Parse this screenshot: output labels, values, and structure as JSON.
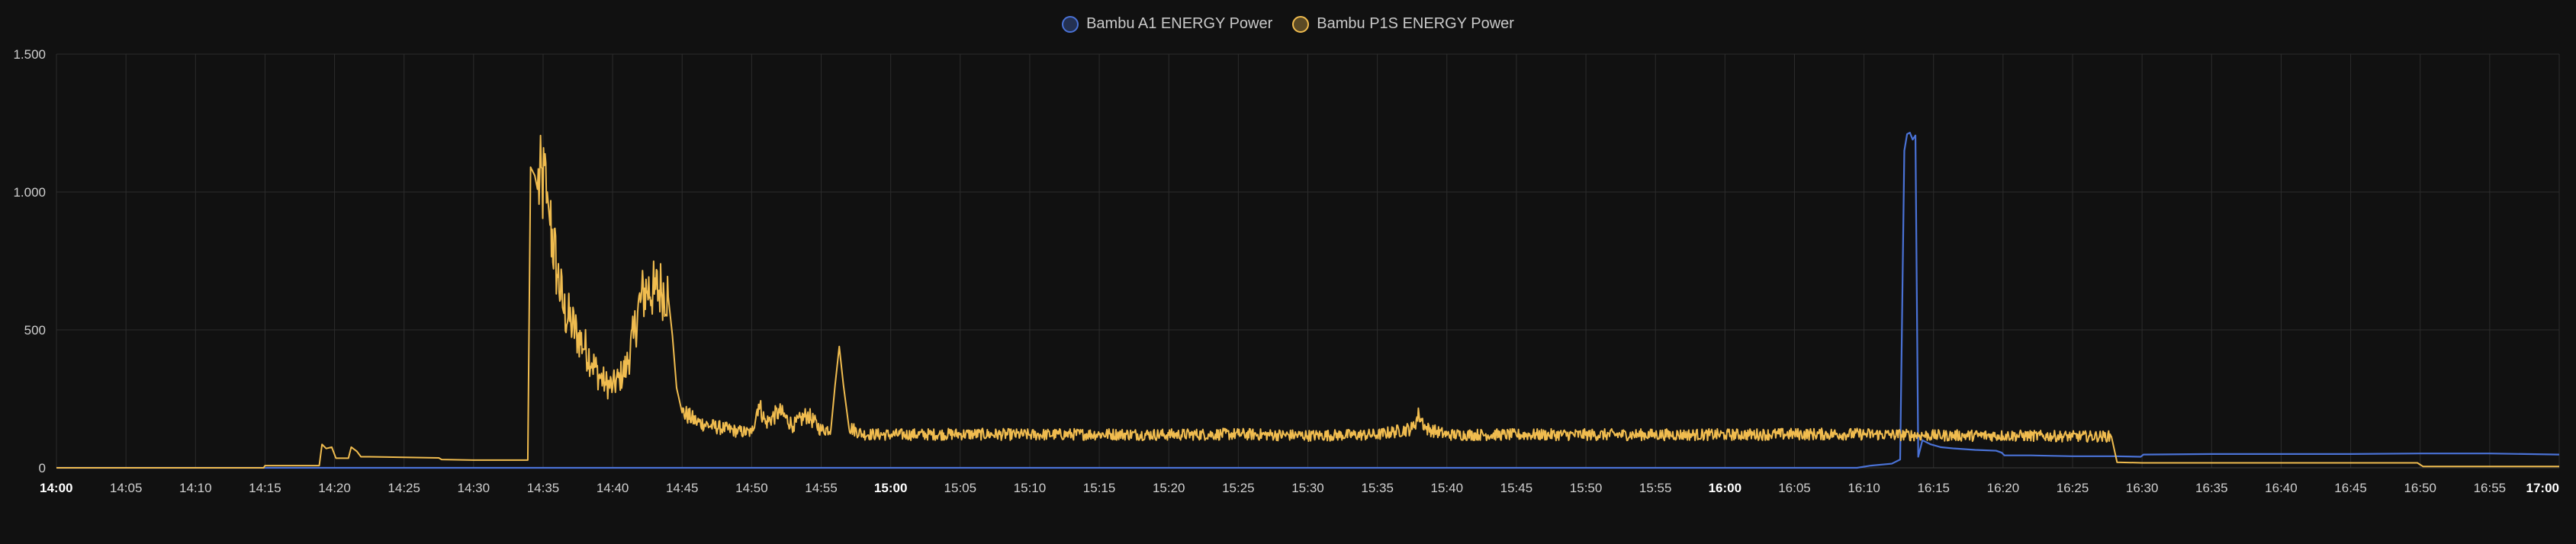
{
  "chart_data": {
    "type": "line",
    "title": "",
    "xlabel": "",
    "ylabel": "",
    "ylim": [
      0,
      1500
    ],
    "xlim": [
      "14:00",
      "17:00"
    ],
    "grid": true,
    "legend_position": "top-center",
    "y_ticks": [
      "0",
      "500",
      "1.000",
      "1.500"
    ],
    "y_tick_values": [
      0,
      500,
      1000,
      1500
    ],
    "x_ticks": [
      {
        "label": "14:00",
        "bold": true
      },
      {
        "label": "14:05",
        "bold": false
      },
      {
        "label": "14:10",
        "bold": false
      },
      {
        "label": "14:15",
        "bold": false
      },
      {
        "label": "14:20",
        "bold": false
      },
      {
        "label": "14:25",
        "bold": false
      },
      {
        "label": "14:30",
        "bold": false
      },
      {
        "label": "14:35",
        "bold": false
      },
      {
        "label": "14:40",
        "bold": false
      },
      {
        "label": "14:45",
        "bold": false
      },
      {
        "label": "14:50",
        "bold": false
      },
      {
        "label": "14:55",
        "bold": false
      },
      {
        "label": "15:00",
        "bold": true
      },
      {
        "label": "15:05",
        "bold": false
      },
      {
        "label": "15:10",
        "bold": false
      },
      {
        "label": "15:15",
        "bold": false
      },
      {
        "label": "15:20",
        "bold": false
      },
      {
        "label": "15:25",
        "bold": false
      },
      {
        "label": "15:30",
        "bold": false
      },
      {
        "label": "15:35",
        "bold": false
      },
      {
        "label": "15:40",
        "bold": false
      },
      {
        "label": "15:45",
        "bold": false
      },
      {
        "label": "15:50",
        "bold": false
      },
      {
        "label": "15:55",
        "bold": false
      },
      {
        "label": "16:00",
        "bold": true
      },
      {
        "label": "16:05",
        "bold": false
      },
      {
        "label": "16:10",
        "bold": false
      },
      {
        "label": "16:15",
        "bold": false
      },
      {
        "label": "16:20",
        "bold": false
      },
      {
        "label": "16:25",
        "bold": false
      },
      {
        "label": "16:30",
        "bold": false
      },
      {
        "label": "16:35",
        "bold": false
      },
      {
        "label": "16:40",
        "bold": false
      },
      {
        "label": "16:45",
        "bold": false
      },
      {
        "label": "16:50",
        "bold": false
      },
      {
        "label": "16:55",
        "bold": false
      },
      {
        "label": "17:00",
        "bold": true
      }
    ],
    "series": [
      {
        "name": "Bambu A1 ENERGY Power",
        "color": "#4a72d6",
        "points": [
          [
            "14:00",
            0
          ],
          [
            "16:09.5",
            0
          ],
          [
            "16:10.5",
            8
          ],
          [
            "16:12",
            15
          ],
          [
            "16:12.6",
            30
          ],
          [
            "16:12.9",
            1150
          ],
          [
            "16:13.1",
            1210
          ],
          [
            "16:13.3",
            1215
          ],
          [
            "16:13.5",
            1190
          ],
          [
            "16:13.7",
            1205
          ],
          [
            "16:13.9",
            40
          ],
          [
            "16:14.2",
            100
          ],
          [
            "16:14.8",
            85
          ],
          [
            "16:15.5",
            75
          ],
          [
            "16:16.5",
            70
          ],
          [
            "16:18",
            65
          ],
          [
            "16:19.5",
            62
          ],
          [
            "16:19.9",
            55
          ],
          [
            "16:20.1",
            45
          ],
          [
            "16:22",
            45
          ],
          [
            "16:25",
            42
          ],
          [
            "16:28",
            42
          ],
          [
            "16:29.9",
            40
          ],
          [
            "16:30.1",
            48
          ],
          [
            "16:35",
            50
          ],
          [
            "16:40",
            50
          ],
          [
            "16:45",
            50
          ],
          [
            "16:50",
            52
          ],
          [
            "16:55",
            52
          ],
          [
            "17:00",
            48
          ]
        ]
      },
      {
        "name": "Bambu P1S ENERGY Power",
        "color": "#f0bc4f",
        "points": [
          [
            "14:00",
            0
          ],
          [
            "14:14.9",
            0
          ],
          [
            "14:15",
            8
          ],
          [
            "14:18.9",
            8
          ],
          [
            "14:19.1",
            85
          ],
          [
            "14:19.4",
            70
          ],
          [
            "14:19.8",
            75
          ],
          [
            "14:20.1",
            35
          ],
          [
            "14:21",
            35
          ],
          [
            "14:21.2",
            75
          ],
          [
            "14:21.6",
            60
          ],
          [
            "14:21.9",
            40
          ],
          [
            "14:22.5",
            40
          ],
          [
            "14:25",
            38
          ],
          [
            "14:27.5",
            36
          ],
          [
            "14:27.7",
            30
          ],
          [
            "14:30",
            28
          ],
          [
            "14:33.9",
            28
          ],
          [
            "14:34.1",
            1090
          ],
          [
            "14:34.4",
            1060
          ],
          [
            "14:34.6",
            1010
          ],
          [
            "14:35.3",
            1000
          ],
          [
            "14:35.5",
            880
          ],
          [
            "14:36",
            700
          ],
          [
            "14:36.5",
            560
          ],
          [
            "14:37",
            520
          ],
          [
            "14:37.5",
            470
          ],
          [
            "14:38",
            430
          ],
          [
            "14:38.5",
            380
          ],
          [
            "14:39",
            330
          ],
          [
            "14:39.5",
            300
          ],
          [
            "14:40",
            290
          ],
          [
            "14:40.5",
            320
          ],
          [
            "14:41",
            360
          ],
          [
            "14:41.5",
            470
          ],
          [
            "14:42",
            600
          ],
          [
            "14:42.5",
            640
          ],
          [
            "14:43",
            630
          ],
          [
            "14:43.5",
            640
          ],
          [
            "14:44",
            620
          ],
          [
            "14:44.3",
            480
          ],
          [
            "14:44.6",
            290
          ],
          [
            "14:45",
            200
          ],
          [
            "14:46",
            165
          ],
          [
            "14:47",
            150
          ],
          [
            "14:48",
            140
          ],
          [
            "14:49",
            130
          ],
          [
            "14:50",
            125
          ],
          [
            "14:50.5",
            230
          ],
          [
            "14:51",
            160
          ],
          [
            "14:52",
            200
          ],
          [
            "14:53",
            150
          ],
          [
            "14:54",
            190
          ],
          [
            "14:55",
            135
          ],
          [
            "14:55.7",
            140
          ],
          [
            "14:56",
            300
          ],
          [
            "14:56.3",
            440
          ],
          [
            "14:56.6",
            300
          ],
          [
            "14:57",
            145
          ],
          [
            "14:58",
            120
          ],
          [
            "15:00",
            118
          ],
          [
            "15:05",
            120
          ],
          [
            "15:10",
            118
          ],
          [
            "15:15",
            120
          ],
          [
            "15:20",
            118
          ],
          [
            "15:25",
            120
          ],
          [
            "15:30",
            115
          ],
          [
            "15:35",
            118
          ],
          [
            "15:37.5",
            140
          ],
          [
            "15:38",
            190
          ],
          [
            "15:38.5",
            140
          ],
          [
            "15:40",
            118
          ],
          [
            "15:45",
            118
          ],
          [
            "15:50",
            118
          ],
          [
            "15:55",
            118
          ],
          [
            "16:00",
            118
          ],
          [
            "16:05",
            120
          ],
          [
            "16:10",
            120
          ],
          [
            "16:15",
            115
          ],
          [
            "16:20",
            115
          ],
          [
            "16:25",
            112
          ],
          [
            "16:27.8",
            112
          ],
          [
            "16:28.2",
            20
          ],
          [
            "16:30",
            18
          ],
          [
            "16:35",
            18
          ],
          [
            "16:40",
            18
          ],
          [
            "16:45",
            18
          ],
          [
            "16:49.8",
            18
          ],
          [
            "16:50.2",
            5
          ],
          [
            "16:55",
            5
          ],
          [
            "17:00",
            5
          ]
        ]
      }
    ]
  }
}
